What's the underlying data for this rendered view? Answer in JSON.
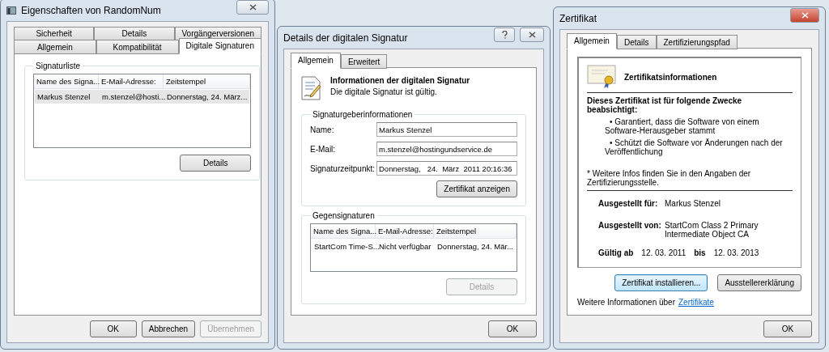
{
  "properties_window": {
    "title": "Eigenschaften von RandomNum",
    "tab_rows": [
      [
        {
          "label": "Sicherheit",
          "selected": false
        },
        {
          "label": "Details",
          "selected": false
        },
        {
          "label": "Vorgängerversionen",
          "selected": false
        }
      ],
      [
        {
          "label": "Allgemein",
          "selected": false
        },
        {
          "label": "Kompatibilität",
          "selected": false
        },
        {
          "label": "Digitale Signaturen",
          "selected": true
        }
      ]
    ],
    "group_title": "Signaturliste",
    "table": {
      "columns": [
        "Name des Signa...",
        "E-Mail-Adresse:",
        "Zeitstempel"
      ],
      "rows": [
        {
          "cells": [
            "Markus Stenzel",
            "m.stenzel@hosti...",
            "Donnerstag, 24. März..."
          ],
          "selected": true
        }
      ]
    },
    "details_button": {
      "label": "Details",
      "disabled": false
    },
    "buttons": [
      {
        "label": "OK",
        "disabled": false
      },
      {
        "label": "Abbrechen",
        "disabled": false
      },
      {
        "label": "Übernehmen",
        "disabled": true
      }
    ]
  },
  "signature_window": {
    "title": "Details der digitalen Signatur",
    "tabs": [
      {
        "label": "Allgemein",
        "selected": true
      },
      {
        "label": "Erweitert",
        "selected": false
      }
    ],
    "heading": "Informationen der digitalen Signatur",
    "status": "Die digitale Signatur ist gültig.",
    "signer_group": {
      "title": "Signaturgeberinformationen",
      "fields": [
        {
          "label": "Name:",
          "value": "Markus Stenzel"
        },
        {
          "label": "E-Mail:",
          "value": "m.stenzel@hostingundservice.de"
        },
        {
          "label": "Signaturzeitpunkt:",
          "value": "Donnerstag,   24.  März  2011 20:16:36"
        }
      ],
      "button": {
        "label": "Zertifikat anzeigen",
        "disabled": false
      }
    },
    "countersign_group": {
      "title": "Gegensignaturen",
      "table": {
        "columns": [
          "Name des Signa...",
          "E-Mail-Adresse:",
          "Zeitstempel"
        ],
        "rows": [
          {
            "cells": [
              "StartCom Time-S...",
              "Nicht verfügbar",
              "Donnerstag, 24. Mär..."
            ],
            "selected": false
          }
        ]
      },
      "button": {
        "label": "Details",
        "disabled": true
      }
    },
    "buttons": [
      {
        "label": "OK",
        "disabled": false
      }
    ]
  },
  "certificate_window": {
    "title": "Zertifikat",
    "tabs": [
      {
        "label": "Allgemein",
        "selected": true
      },
      {
        "label": "Details",
        "selected": false
      },
      {
        "label": "Zertifizierungspfad",
        "selected": false
      }
    ],
    "heading": "Zertifikatsinformationen",
    "purpose_title": "Dieses Zertifikat ist für folgende Zwecke beabsichtigt:",
    "purposes": [
      "• Garantiert, dass die Software von einem Software-Herausgeber stammt",
      "• Schützt die Software vor Änderungen nach der Veröffentlichung"
    ],
    "note": "* Weitere Infos finden Sie in den Angaben der Zertifizierungsstelle.",
    "issued_to": {
      "label": "Ausgestellt für:",
      "value": "Markus Stenzel"
    },
    "issued_by": {
      "label": "Ausgestellt von:",
      "value": "StartCom Class 2 Primary Intermediate Object CA"
    },
    "validity": {
      "from_label": "Gültig ab",
      "from": "12. 03. 2011",
      "to_label": "bis",
      "to": "12. 03. 2013"
    },
    "actions": [
      {
        "label": "Zertifikat installieren...",
        "focused": true
      },
      {
        "label": "Ausstellererklärung",
        "focused": false
      }
    ],
    "footer_text": "Weitere Informationen über",
    "footer_link": "Zertifikate",
    "buttons": [
      {
        "label": "OK",
        "disabled": false
      }
    ]
  }
}
